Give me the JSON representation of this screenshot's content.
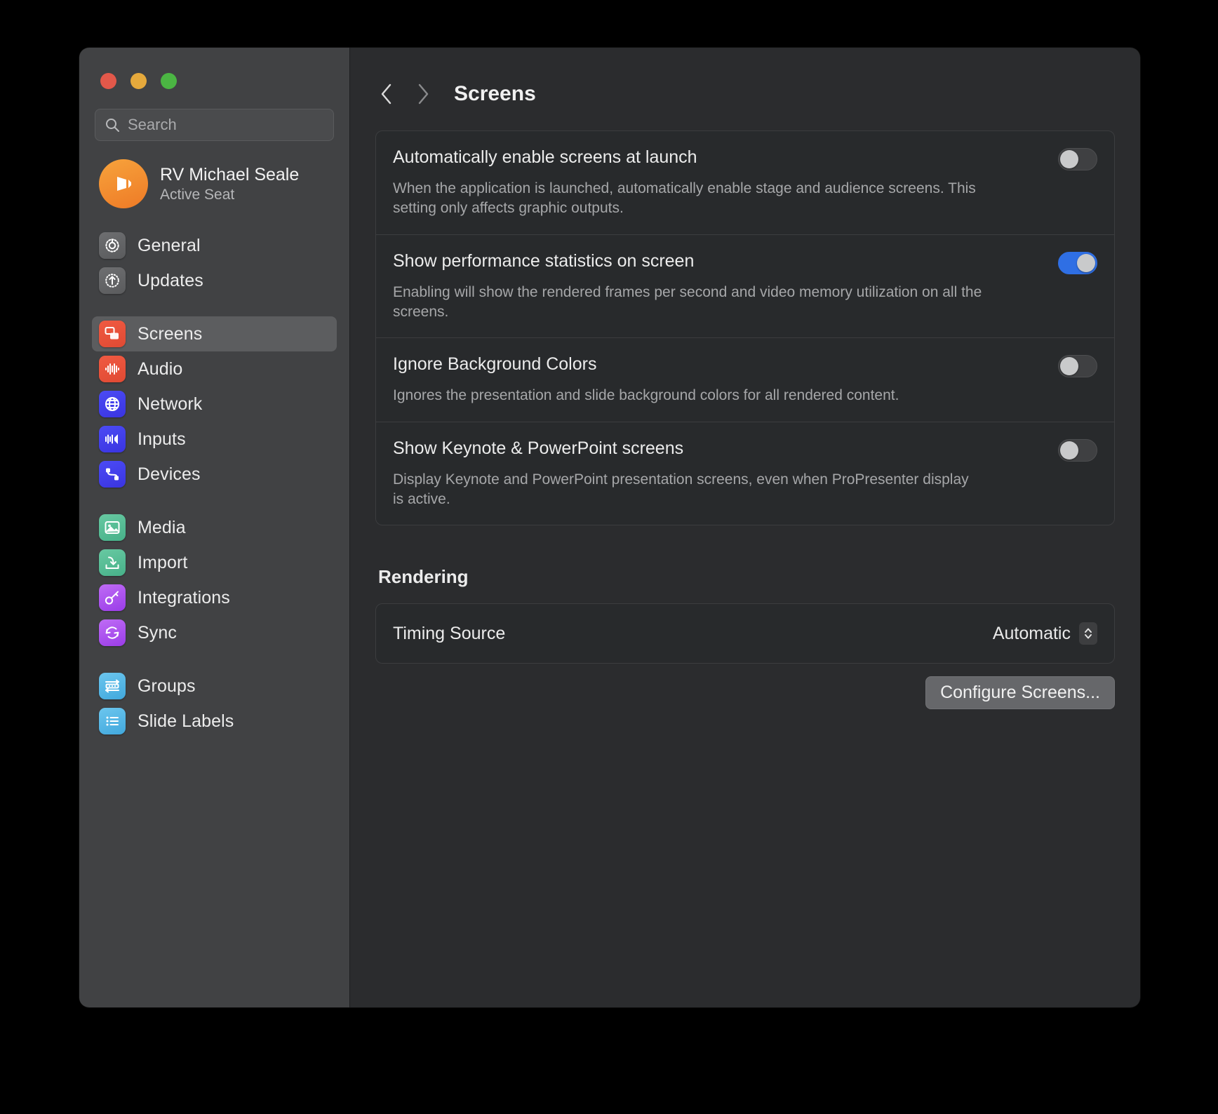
{
  "window": {
    "traffic_lights": [
      "close",
      "minimize",
      "zoom"
    ],
    "title": "Screens"
  },
  "search": {
    "placeholder": "Search",
    "value": "",
    "icon": "search-icon"
  },
  "account": {
    "name": "RV Michael Seale",
    "status": "Active Seat",
    "avatar_icon": "propresenter-logo-icon"
  },
  "sidebar": {
    "groups": [
      {
        "items": [
          {
            "label": "General",
            "icon": "gear-icon",
            "color": "ic-gray",
            "selected": false
          },
          {
            "label": "Updates",
            "icon": "update-arrow-icon",
            "color": "ic-gray",
            "selected": false
          }
        ]
      },
      {
        "items": [
          {
            "label": "Screens",
            "icon": "screens-icon",
            "color": "ic-red",
            "selected": true
          },
          {
            "label": "Audio",
            "icon": "waveform-icon",
            "color": "ic-red",
            "selected": false
          },
          {
            "label": "Network",
            "icon": "globe-icon",
            "color": "ic-blue",
            "selected": false
          },
          {
            "label": "Inputs",
            "icon": "input-signal-icon",
            "color": "ic-blue",
            "selected": false
          },
          {
            "label": "Devices",
            "icon": "devices-link-icon",
            "color": "ic-blue",
            "selected": false
          }
        ]
      },
      {
        "items": [
          {
            "label": "Media",
            "icon": "photo-icon",
            "color": "ic-green",
            "selected": false
          },
          {
            "label": "Import",
            "icon": "import-tray-icon",
            "color": "ic-green",
            "selected": false
          },
          {
            "label": "Integrations",
            "icon": "key-icon",
            "color": "ic-purple",
            "selected": false
          },
          {
            "label": "Sync",
            "icon": "sync-arrows-icon",
            "color": "ic-purple",
            "selected": false
          }
        ]
      },
      {
        "items": [
          {
            "label": "Groups",
            "icon": "groups-icon",
            "color": "ic-cyan",
            "selected": false
          },
          {
            "label": "Slide Labels",
            "icon": "list-icon",
            "color": "ic-cyan",
            "selected": false
          }
        ]
      }
    ]
  },
  "toolbar": {
    "back_icon": "chevron-left-icon",
    "forward_icon": "chevron-right-icon",
    "title": "Screens"
  },
  "settings": {
    "rows": [
      {
        "title": "Automatically enable screens at launch",
        "desc": "When the application is launched, automatically enable stage and audience screens. This setting only affects graphic outputs.",
        "toggle": "off"
      },
      {
        "title": "Show performance statistics on screen",
        "desc": "Enabling will show the rendered frames per second and video memory utilization on all the screens.",
        "toggle": "on"
      },
      {
        "title": "Ignore Background Colors",
        "desc": "Ignores the presentation and slide background colors for all rendered content.",
        "toggle": "off"
      },
      {
        "title": "Show Keynote & PowerPoint screens",
        "desc": "Display Keynote and PowerPoint presentation screens, even when ProPresenter display is active.",
        "toggle": "off"
      }
    ]
  },
  "rendering": {
    "heading": "Rendering",
    "timing_source_label": "Timing Source",
    "timing_source_value": "Automatic",
    "configure_button": "Configure Screens..."
  },
  "annotation": {
    "type": "arrow",
    "color": "#F5A33C",
    "points_to": "show-performance-statistics-toggle"
  },
  "colors": {
    "accent_toggle_on": "#2F6FE4",
    "window_bg": "#2B2C2E",
    "sidebar_bg": "#414244",
    "annotation": "#F5A33C"
  }
}
